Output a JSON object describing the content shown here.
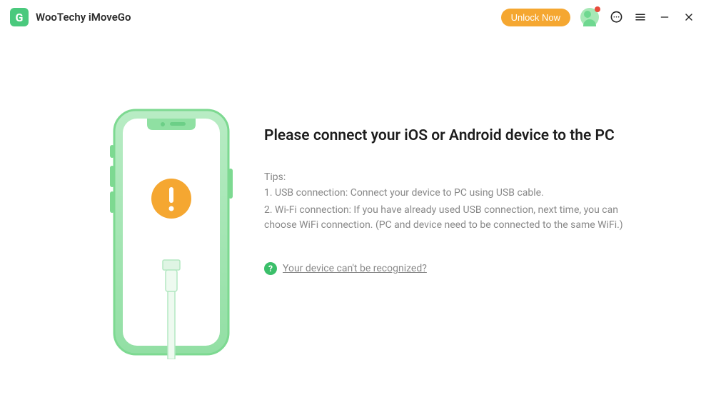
{
  "header": {
    "app_title": "WooTechy iMoveGo",
    "unlock_label": "Unlock Now"
  },
  "main": {
    "heading": "Please connect your iOS or Android device to the PC",
    "tips_label": "Tips:",
    "tip1": "1. USB connection: Connect your device to PC using USB cable.",
    "tip2": "2. Wi-Fi connection: If you have already used USB connection, next time, you can choose WiFi connection. (PC and device need to be connected to the same WiFi.)",
    "help_link": "Your device can't be recognized?"
  },
  "colors": {
    "accent_green": "#4ac97d",
    "accent_orange": "#f5a731",
    "warning_orange": "#f5a731"
  }
}
